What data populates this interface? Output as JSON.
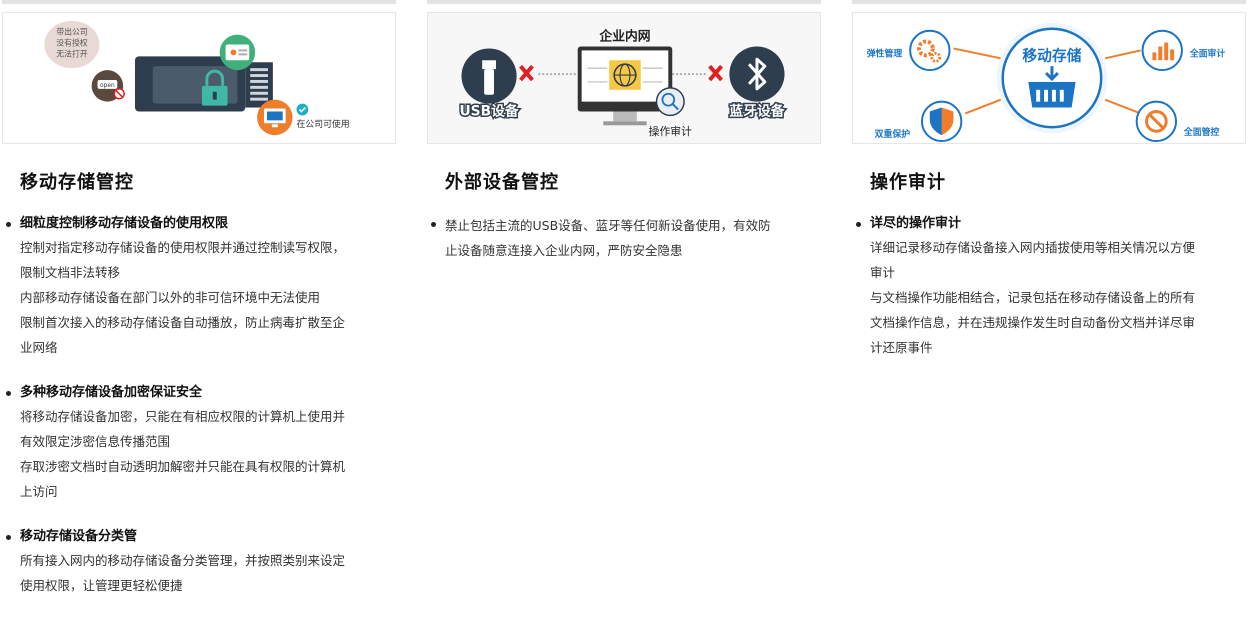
{
  "columns": [
    {
      "title": "移动存储管控",
      "illus": {
        "bubble": [
          "带出公司",
          "没有授权",
          "无法打开"
        ],
        "open_label": "open",
        "caption": "在公司可使用"
      },
      "items": [
        {
          "head": "细粒度控制移动存储设备的使用权限",
          "lines": [
            "控制对指定移动存储设备的使用权限并通过控制读写权限，",
            "限制文档非法转移",
            "内部移动存储设备在部门以外的非可信环境中无法使用",
            "限制首次接入的移动存储设备自动播放，防止病毒扩散至企",
            "业网络"
          ]
        },
        {
          "head": "多种移动存储设备加密保证安全",
          "lines": [
            "将移动存储设备加密，只能在有相应权限的计算机上使用并",
            "有效限定涉密信息传播范围",
            "存取涉密文档时自动透明加解密并只能在具有权限的计算机",
            "上访问"
          ]
        },
        {
          "head": "移动存储设备分类管",
          "lines": [
            "所有接入网内的移动存储设备分类管理，并按照类别来设定",
            "使用权限，让管理更轻松便捷"
          ]
        }
      ]
    },
    {
      "title": "外部设备管控",
      "illus": {
        "network_label": "企业内网",
        "usb_label": "USB设备",
        "bluetooth_label": "蓝牙设备",
        "audit_label": "操作审计"
      },
      "items": [
        {
          "head": "",
          "lines": [
            "禁止包括主流的USB设备、蓝牙等任何新设备使用，有效防",
            "止设备随意连接入企业内网，严防安全隐患"
          ]
        }
      ]
    },
    {
      "title": "操作审计",
      "illus": {
        "center_label": "移动存储",
        "elastic": "弹性管理",
        "full_audit": "全面审计",
        "dual_protect": "双重保护",
        "full_control": "全面管控"
      },
      "items": [
        {
          "head": "详尽的操作审计",
          "lines": [
            "详细记录移动存储设备接入网内插拔使用等相关情况以方便",
            "审计",
            "与文档操作功能相结合，记录包括在移动存储设备上的所有",
            "文档操作信息，并在违规操作发生时自动备份文档并详尽审",
            "计还原事件"
          ]
        }
      ]
    }
  ],
  "colors": {
    "accent_blue": "#1b75c4",
    "accent_orange": "#f07d2a",
    "deny_red": "#e02020",
    "device_dark": "#2f3e4e"
  }
}
